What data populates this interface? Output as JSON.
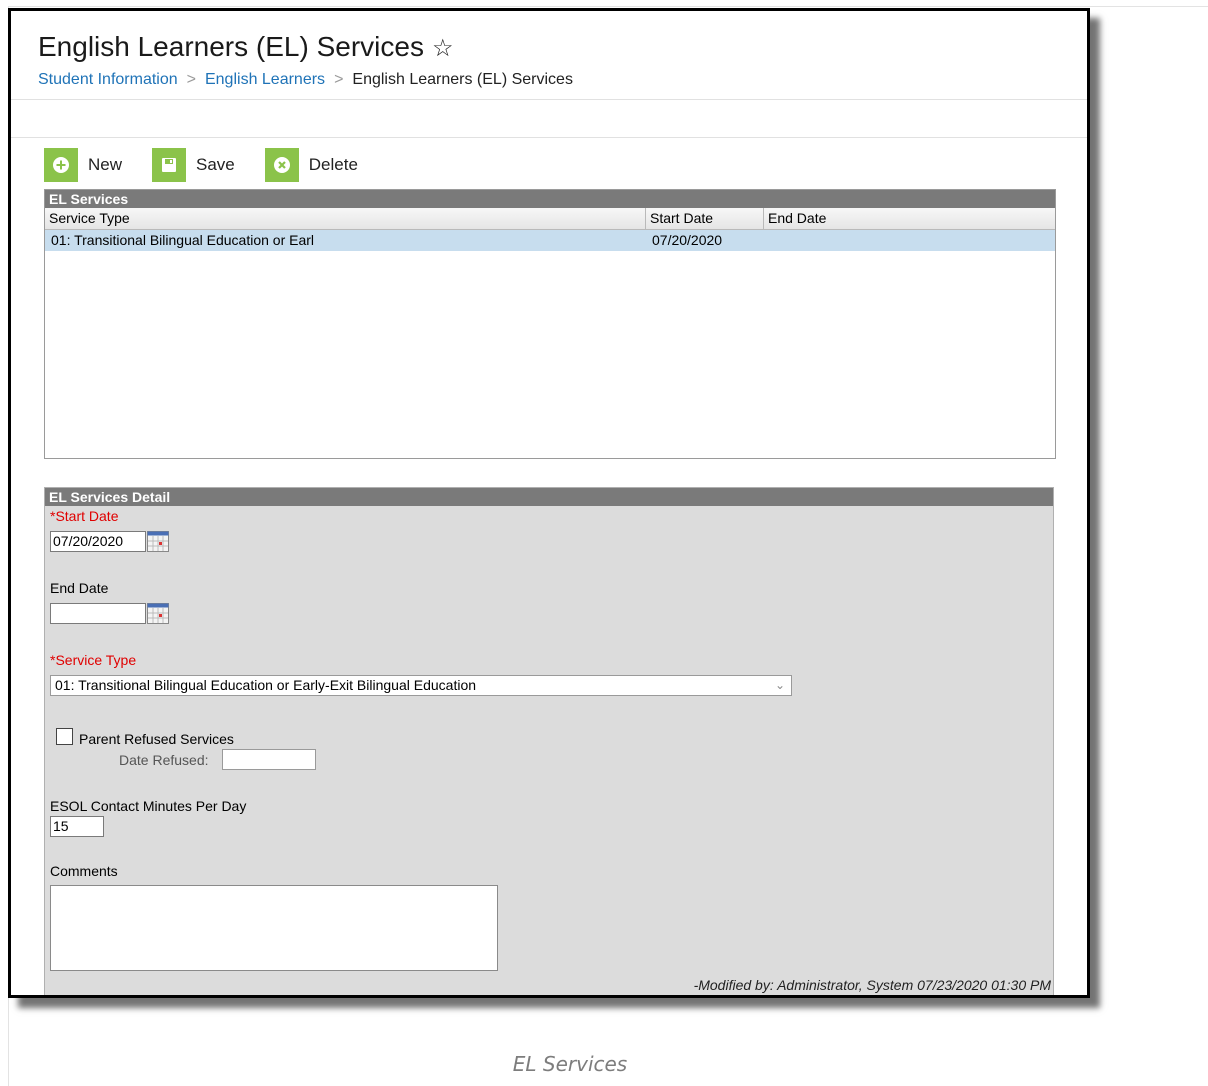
{
  "header": {
    "title": "English Learners (EL) Services",
    "breadcrumb": [
      "Student Information",
      "English Learners",
      "English Learners (EL) Services"
    ]
  },
  "toolbar": {
    "new_label": "New",
    "save_label": "Save",
    "delete_label": "Delete"
  },
  "services_grid": {
    "title": "EL Services",
    "columns": [
      "Service Type",
      "Start Date",
      "End Date"
    ],
    "rows": [
      {
        "service_type": "01: Transitional Bilingual Education or Earl",
        "start_date": "07/20/2020",
        "end_date": ""
      }
    ]
  },
  "detail": {
    "title": "EL Services Detail",
    "start_date_label": "*Start Date",
    "start_date_value": "07/20/2020",
    "end_date_label": "End Date",
    "end_date_value": "",
    "service_type_label": "*Service Type",
    "service_type_value": "01: Transitional Bilingual Education or Early-Exit Bilingual Education",
    "parent_refused_label": "Parent Refused Services",
    "parent_refused_checked": false,
    "date_refused_label": "Date Refused:",
    "date_refused_value": "",
    "esol_label": "ESOL Contact Minutes Per Day",
    "esol_value": "15",
    "comments_label": "Comments",
    "comments_value": "",
    "modified_by": "-Modified by: Administrator, System 07/23/2020 01:30 PM"
  },
  "caption": "EL Services",
  "colors": {
    "toolbar_button": "#8bc34a",
    "link": "#1f73b7",
    "required": "#e00000",
    "section_header": "#7a7a7a",
    "selected_row": "#c7ddee",
    "detail_background": "#dcdcdc"
  }
}
